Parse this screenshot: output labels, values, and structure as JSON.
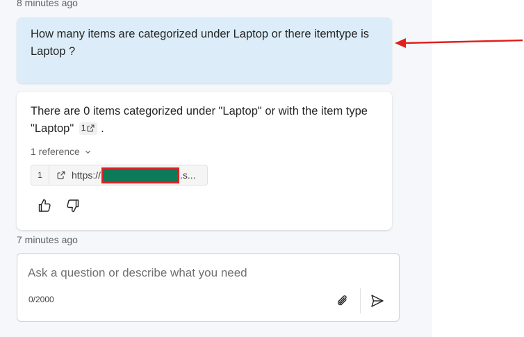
{
  "timestamps": {
    "top": "8 minutes ago",
    "bottom": "7 minutes ago"
  },
  "user_message": {
    "text": "How many items are categorized under Laptop or there itemtype is Laptop ?"
  },
  "bot_message": {
    "text": "There are 0 items categorized under \"Laptop\" or with the item type \"Laptop\"",
    "citation_number": "1",
    "trailing_punct": ".",
    "references_toggle": "1 reference",
    "references": [
      {
        "number": "1",
        "url_prefix": "https://",
        "url_suffix": ".s..."
      }
    ],
    "feedback": {
      "like_icon": "thumbs-up-icon",
      "dislike_icon": "thumbs-down-icon"
    }
  },
  "composer": {
    "placeholder": "Ask a question or describe what you need",
    "value": "",
    "char_count": "0/2000",
    "attach_icon": "paperclip-icon",
    "send_icon": "send-icon"
  },
  "colors": {
    "panel_bg": "#f5f7fa",
    "user_bubble_bg": "#dcedf9",
    "redaction_fill": "#0d7a5a",
    "annotation_red": "#e02020"
  }
}
